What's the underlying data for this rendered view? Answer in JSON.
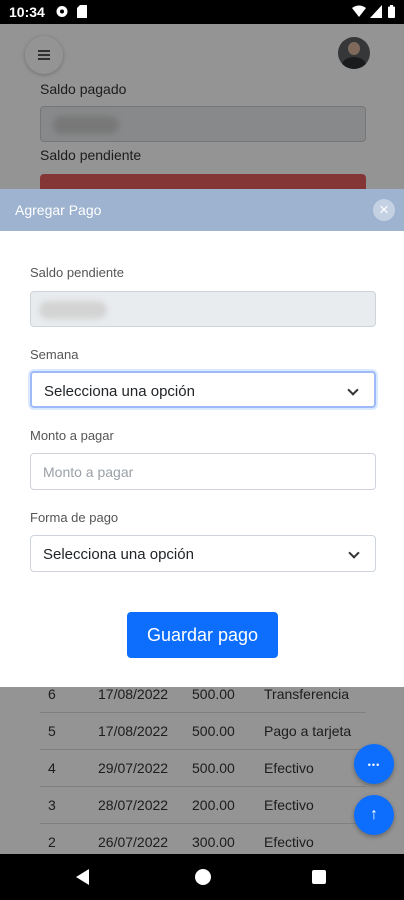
{
  "status_bar": {
    "time": "10:34"
  },
  "background": {
    "saldo_pagado_label": "Saldo pagado",
    "saldo_pendiente_label": "Saldo pendiente",
    "table_rows": [
      {
        "num": "6",
        "date": "17/08/2022",
        "amount": "500.00",
        "method": "Transferencia"
      },
      {
        "num": "5",
        "date": "17/08/2022",
        "amount": "500.00",
        "method": "Pago a tarjeta"
      },
      {
        "num": "4",
        "date": "29/07/2022",
        "amount": "500.00",
        "method": "Efectivo"
      },
      {
        "num": "3",
        "date": "28/07/2022",
        "amount": "200.00",
        "method": "Efectivo"
      },
      {
        "num": "2",
        "date": "26/07/2022",
        "amount": "300.00",
        "method": "Efectivo"
      }
    ]
  },
  "modal": {
    "title": "Agregar Pago",
    "close_symbol": "×",
    "saldo_pendiente_label": "Saldo pendiente",
    "semana_label": "Semana",
    "semana_value": "Selecciona una opción",
    "monto_label": "Monto a pagar",
    "monto_placeholder": "Monto a pagar",
    "forma_pago_label": "Forma de pago",
    "forma_pago_value": "Selecciona una opción",
    "save_label": "Guardar pago"
  },
  "fab": {
    "more_symbol": "•••",
    "up_symbol": "↑"
  },
  "colors": {
    "primary": "#0d6efd",
    "modal_header": "#9db3cf",
    "danger": "#e35d5d"
  }
}
